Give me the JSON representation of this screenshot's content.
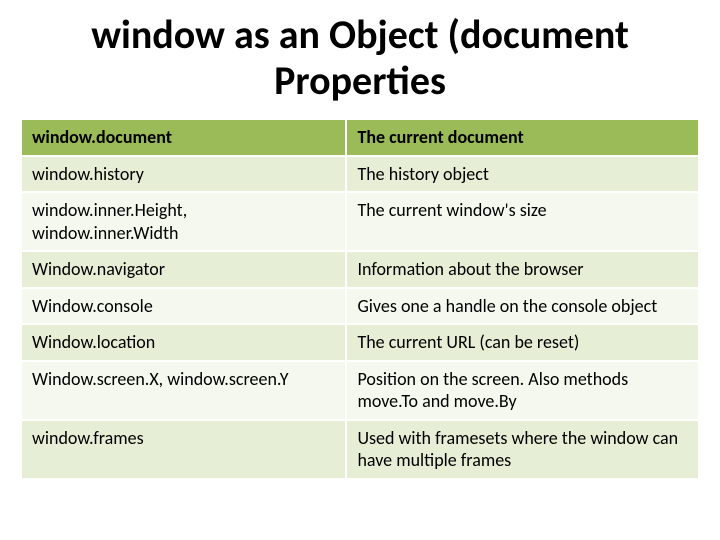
{
  "title": {
    "strong": "window",
    "rest": " as an Object (document Properties"
  },
  "table": {
    "header": {
      "c1": "window.document",
      "c2": "The current document"
    },
    "rows": [
      {
        "c1": "window.history",
        "c2": "The history object"
      },
      {
        "c1": "window.inner.Height, window.inner.Width",
        "c2": "The current window's size"
      },
      {
        "c1": "Window.navigator",
        "c2": "Information about the browser"
      },
      {
        "c1": "Window.console",
        "c2": "Gives one a handle on the console object"
      },
      {
        "c1": "Window.location",
        "c2": "The current URL (can be reset)"
      },
      {
        "c1": "Window.screen.X, window.screen.Y",
        "c2": "Position on the screen.  Also methods move.To and move.By"
      },
      {
        "c1": "window.frames",
        "c2": "Used with framesets where the window can have multiple frames"
      }
    ]
  }
}
